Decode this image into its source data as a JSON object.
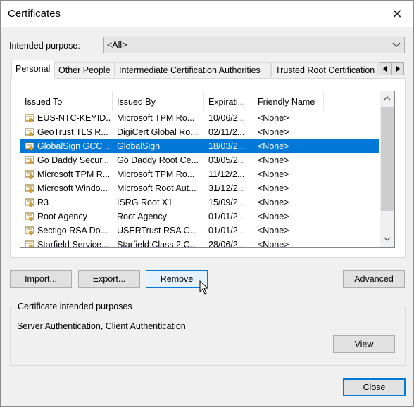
{
  "window": {
    "title": "Certificates"
  },
  "intended_purpose": {
    "label": "Intended purpose:",
    "value": "<All>"
  },
  "tabs": [
    {
      "label": "Personal",
      "active": true
    },
    {
      "label": "Other People"
    },
    {
      "label": "Intermediate Certification Authorities"
    },
    {
      "label": "Trusted Root Certification"
    }
  ],
  "columns": [
    "Issued To",
    "Issued By",
    "Expirati...",
    "Friendly Name"
  ],
  "certificates": [
    {
      "issued_to": "EUS-NTC-KEYID...",
      "issued_by": "Microsoft TPM Ro...",
      "expiration": "10/06/2...",
      "friendly_name": "<None>"
    },
    {
      "issued_to": "GeoTrust TLS R...",
      "issued_by": "DigiCert Global Ro...",
      "expiration": "02/11/2...",
      "friendly_name": "<None>"
    },
    {
      "issued_to": "GlobalSign GCC ...",
      "issued_by": "GlobalSign",
      "expiration": "18/03/2...",
      "friendly_name": "<None>",
      "selected": true
    },
    {
      "issued_to": "Go Daddy Secur...",
      "issued_by": "Go Daddy Root Ce...",
      "expiration": "03/05/2...",
      "friendly_name": "<None>"
    },
    {
      "issued_to": "Microsoft TPM R...",
      "issued_by": "Microsoft TPM Ro...",
      "expiration": "11/12/2...",
      "friendly_name": "<None>"
    },
    {
      "issued_to": "Microsoft Windo...",
      "issued_by": "Microsoft Root Aut...",
      "expiration": "31/12/2...",
      "friendly_name": "<None>"
    },
    {
      "issued_to": "R3",
      "issued_by": "ISRG Root X1",
      "expiration": "15/09/2...",
      "friendly_name": "<None>"
    },
    {
      "issued_to": "Root Agency",
      "issued_by": "Root Agency",
      "expiration": "01/01/2...",
      "friendly_name": "<None>"
    },
    {
      "issued_to": "Sectigo RSA Do...",
      "issued_by": "USERTrust RSA C...",
      "expiration": "01/01/2...",
      "friendly_name": "<None>"
    },
    {
      "issued_to": "Starfield Service...",
      "issued_by": "Starfield Class 2 C...",
      "expiration": "28/06/2...",
      "friendly_name": "<None>"
    }
  ],
  "buttons": {
    "import": "Import...",
    "export": "Export...",
    "remove": "Remove",
    "advanced": "Advanced",
    "view": "View",
    "close": "Close"
  },
  "purposes": {
    "title": "Certificate intended purposes",
    "text": "Server Authentication, Client Authentication"
  },
  "icons": {
    "close": "close-icon",
    "dropdown": "chevron-down-icon",
    "certificate": "certificate-icon",
    "tab_left": "tab-scroll-left-icon",
    "tab_right": "tab-scroll-right-icon",
    "scroll_up": "scroll-up-icon",
    "scroll_down": "scroll-down-icon",
    "cursor": "mouse-pointer-icon"
  },
  "colors": {
    "selection": "#0078d7",
    "focus_border": "#0078d7"
  }
}
